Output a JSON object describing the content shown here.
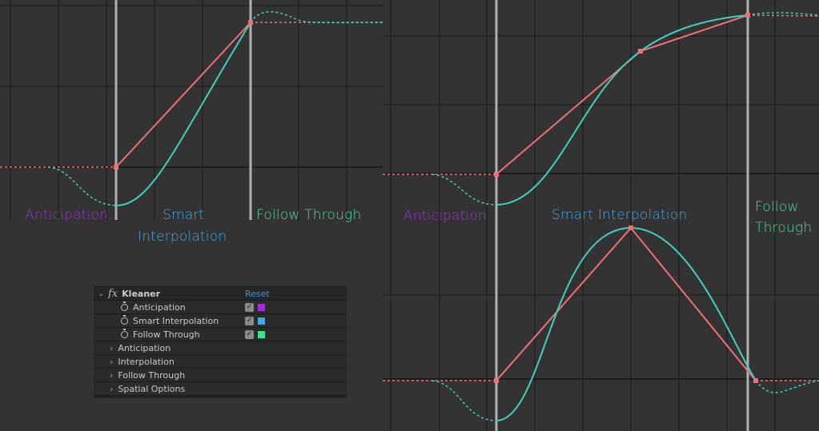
{
  "colors": {
    "background": "#333333",
    "grid": "#1f1f1f",
    "marker": "#b0b0b0",
    "value_curve": "#f07070",
    "smart_curve": "#40d0c0",
    "anticipation": "#a030d0",
    "smart_interpolation": "#40a8e8",
    "follow_through": "#40e090",
    "reset_link": "#3a8ee6"
  },
  "graph_left": {
    "labels": {
      "anticipation": "Anticipation",
      "smart_line1": "Smart",
      "smart_line2": "Interpolation",
      "follow_through": "Follow Through"
    }
  },
  "graph_right": {
    "labels": {
      "anticipation": "Anticipation",
      "smart_interpolation": "Smart Interpolation",
      "follow_line1": "Follow",
      "follow_line2": "Through"
    }
  },
  "effect_panel": {
    "effect_icon": "fx-icon",
    "effect_name": "Kleaner",
    "reset_label": "Reset",
    "toggles": [
      {
        "label": "Anticipation",
        "checked": true,
        "color": "#a030d0"
      },
      {
        "label": "Smart Interpolation",
        "checked": true,
        "color": "#40a8e8"
      },
      {
        "label": "Follow Through",
        "checked": true,
        "color": "#40e090"
      }
    ],
    "groups": [
      {
        "label": "Anticipation"
      },
      {
        "label": "Interpolation"
      },
      {
        "label": "Follow Through"
      },
      {
        "label": "Spatial Options"
      }
    ]
  }
}
